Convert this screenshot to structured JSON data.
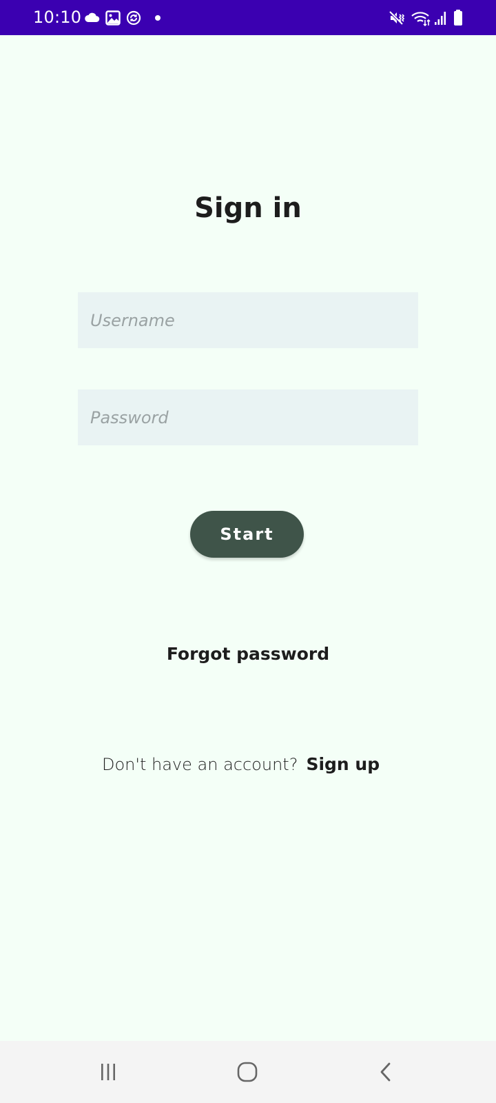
{
  "status_bar": {
    "time": "10:10",
    "left_icons": [
      "cloud-icon",
      "gallery-icon",
      "sync-icon",
      "notification-dot"
    ],
    "right_icons": [
      "mute-vibrate-icon",
      "wifi-icon",
      "signal-icon",
      "battery-icon"
    ],
    "background": "#3b00b1"
  },
  "screen": {
    "title": "Sign in",
    "background": "#f4fff7"
  },
  "form": {
    "username_placeholder": "Username",
    "username_value": "",
    "password_placeholder": "Password",
    "password_value": "",
    "start_label": "Start",
    "button_color": "#3f5449",
    "field_color": "#e9f3f3"
  },
  "links": {
    "forgot_password": "Forgot password",
    "signup_prompt": "Don't have an account?",
    "signup": "Sign up"
  },
  "nav_bar": {
    "buttons": [
      "recents-icon",
      "home-icon",
      "back-icon"
    ]
  }
}
